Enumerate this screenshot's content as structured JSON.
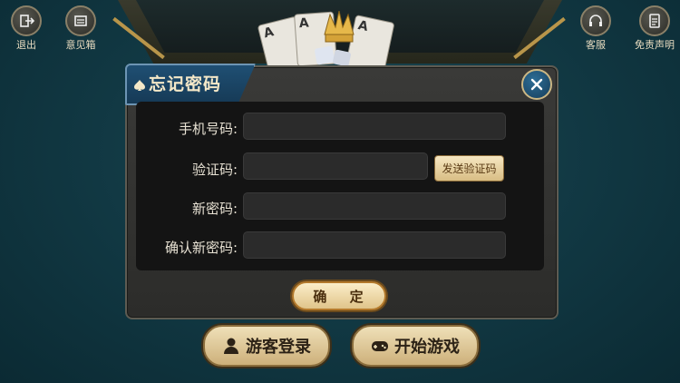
{
  "top_left": {
    "exit_label": "退出",
    "feedback_label": "意见箱"
  },
  "top_right": {
    "service_label": "客服",
    "disclaimer_label": "免责声明"
  },
  "dialog": {
    "title": "忘记密码",
    "fields": {
      "phone_label": "手机号码:",
      "phone_value": "",
      "code_label": "验证码:",
      "code_value": "",
      "new_password_label": "新密码:",
      "new_password_value": "",
      "confirm_password_label": "确认新密码:",
      "confirm_password_value": ""
    },
    "send_code_label": "发送验证码",
    "confirm_label": "确 定"
  },
  "bottom": {
    "guest_login_label": "游客登录",
    "start_game_label": "开始游戏"
  },
  "cards": [
    "A",
    "A",
    "A"
  ],
  "colors": {
    "background": "#123a45",
    "gold_button": "#e0c48a",
    "title_tab": "#1f4f73"
  }
}
